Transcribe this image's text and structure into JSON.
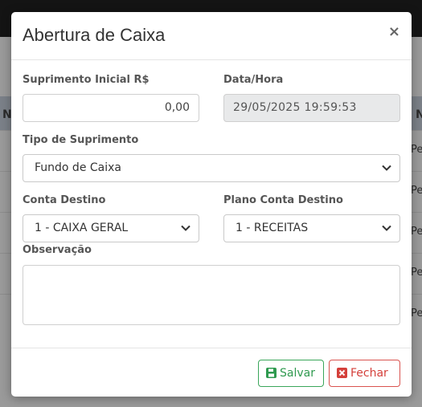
{
  "modal": {
    "title": "Abertura de Caixa",
    "close_glyph": "×"
  },
  "form": {
    "suprimento_label": "Suprimento Inicial R$",
    "suprimento_value": "0,00",
    "datahora_label": "Data/Hora",
    "datahora_value": "29/05/2025 19:59:53",
    "tipo_label": "Tipo de Suprimento",
    "tipo_value": "Fundo de Caixa",
    "conta_label": "Conta Destino",
    "conta_value": "1 - CAIXA GERAL",
    "plano_label": "Plano Conta Destino",
    "plano_value": "1 - RECEITAS",
    "observacao_label": "Observação",
    "observacao_value": ""
  },
  "footer": {
    "save_label": "Salvar",
    "close_label": "Fechar"
  },
  "background": {
    "header_left": "N",
    "header_right": "N",
    "row_cells": [
      "Pe",
      "Pe",
      "Pe",
      "Pe",
      "Pe"
    ]
  },
  "colors": {
    "save": "#2f9a4f",
    "close": "#d43f3a"
  },
  "icons": {
    "close": "close-icon",
    "save": "floppy-disk-icon",
    "fechar": "x-square-icon",
    "select": "chevron-down-icon"
  }
}
